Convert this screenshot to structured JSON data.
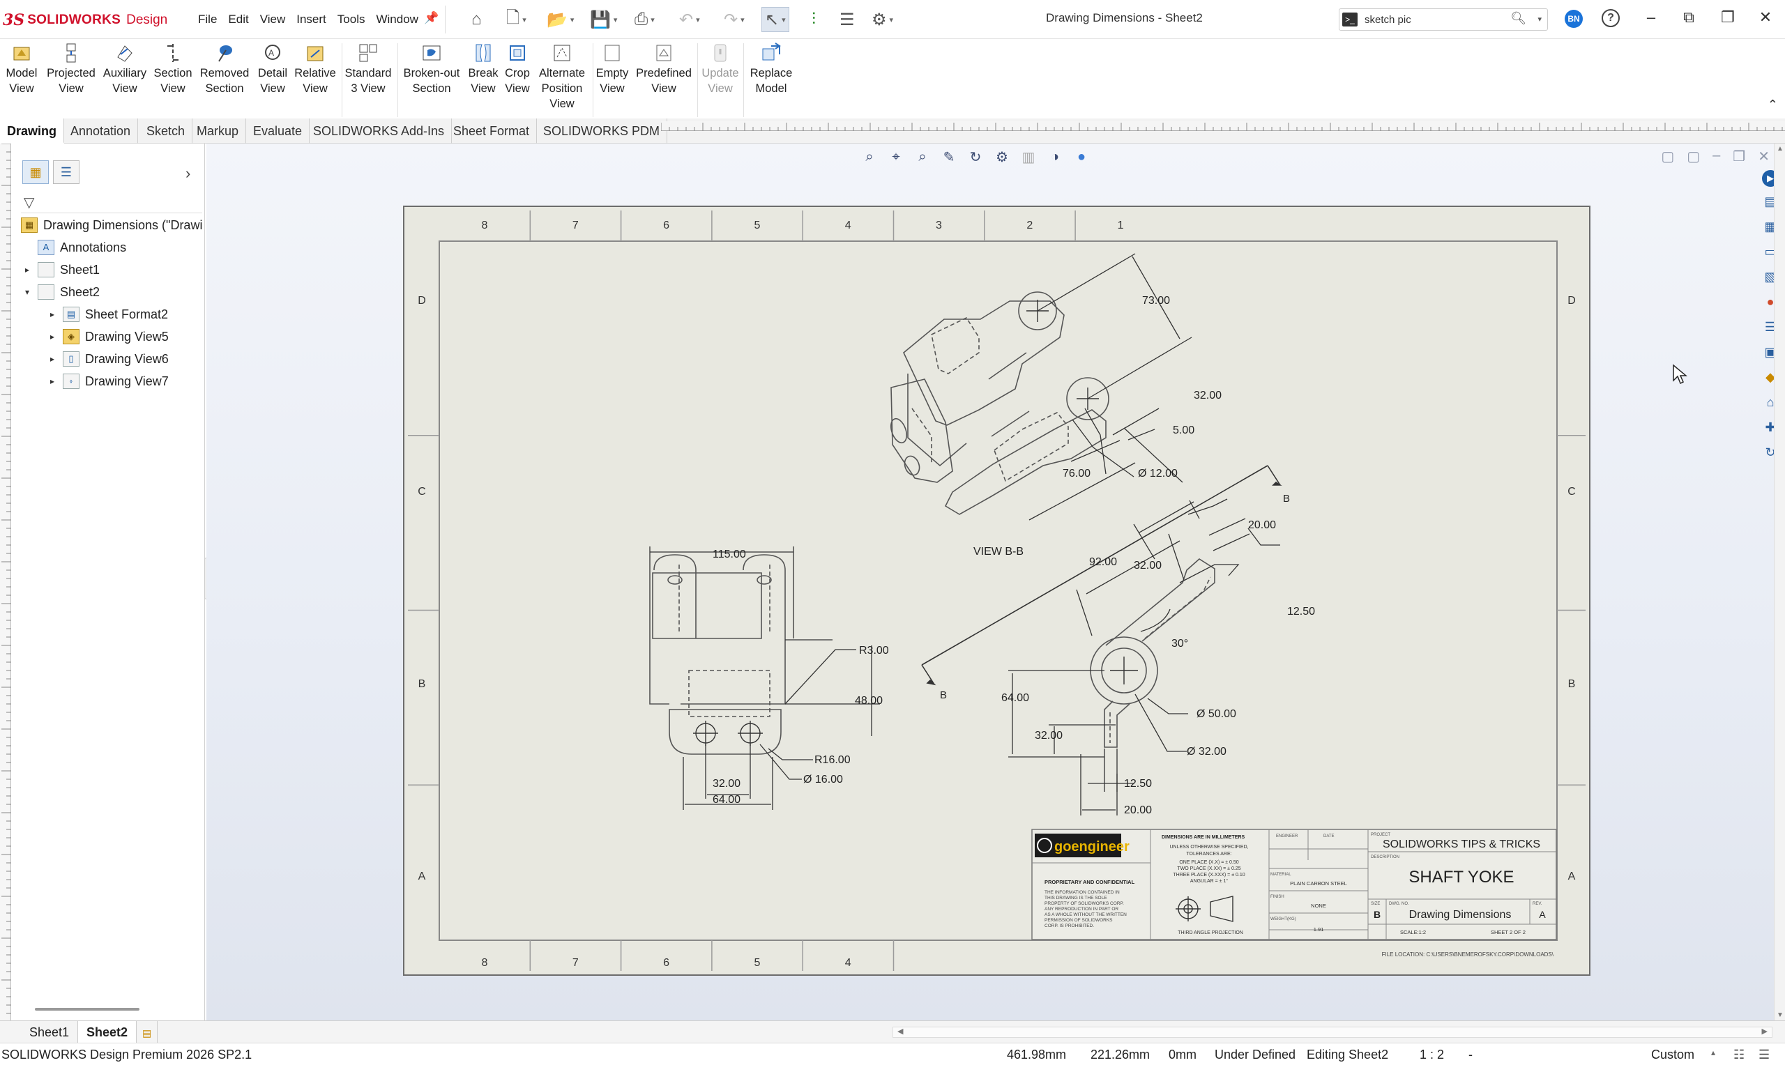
{
  "app": {
    "brand_ds": "3S",
    "brand_name": "SOLIDWORKS",
    "brand_suffix": "Design"
  },
  "menu": [
    "File",
    "Edit",
    "View",
    "Insert",
    "Tools",
    "Window"
  ],
  "window_title": "Drawing Dimensions - Sheet2",
  "search": {
    "value": "sketch pic",
    "placeholder": ""
  },
  "user_initials": "BN",
  "command_manager": [
    {
      "label": "Model\nView",
      "enabled": true
    },
    {
      "label": "Projected\nView",
      "enabled": true
    },
    {
      "label": "Auxiliary\nView",
      "enabled": true
    },
    {
      "label": "Section\nView",
      "enabled": true
    },
    {
      "label": "Removed\nSection",
      "enabled": true
    },
    {
      "label": "Detail\nView",
      "enabled": true
    },
    {
      "label": "Relative\nView",
      "enabled": true
    },
    {
      "label": "Standard\n3 View",
      "enabled": true
    },
    {
      "label": "Broken-out\nSection",
      "enabled": true
    },
    {
      "label": "Break\nView",
      "enabled": true
    },
    {
      "label": "Crop\nView",
      "enabled": true
    },
    {
      "label": "Alternate\nPosition\nView",
      "enabled": true
    },
    {
      "label": "Empty\nView",
      "enabled": true
    },
    {
      "label": "Predefined\nView",
      "enabled": true
    },
    {
      "label": "Update\nView",
      "enabled": false
    },
    {
      "label": "Replace\nModel",
      "enabled": true
    }
  ],
  "tabs": [
    "Drawing",
    "Annotation",
    "Sketch",
    "Markup",
    "Evaluate",
    "SOLIDWORKS Add-Ins",
    "Sheet Format",
    "SOLIDWORKS PDM"
  ],
  "active_tab": "Drawing",
  "tree": {
    "root": "Drawing Dimensions (\"Drawi",
    "items": [
      {
        "label": "Annotations"
      },
      {
        "label": "Sheet1"
      },
      {
        "label": "Sheet2"
      },
      {
        "label": "Sheet Format2"
      },
      {
        "label": "Drawing View5"
      },
      {
        "label": "Drawing View6"
      },
      {
        "label": "Drawing View7"
      }
    ]
  },
  "sheet": {
    "zone_cols": [
      "8",
      "7",
      "6",
      "5",
      "4",
      "3",
      "2",
      "1"
    ],
    "zone_rows": [
      "D",
      "C",
      "B",
      "A"
    ],
    "view_label": "VIEW B-B",
    "section_letter": "B",
    "dims_iso": [
      "73.00",
      "32.00",
      "5.00",
      "76.00",
      "Ø 12.00"
    ],
    "dims_front": [
      "115.00",
      "R3.00",
      "48.00",
      "R16.00",
      "Ø 16.00",
      "32.00",
      "64.00"
    ],
    "dims_section": [
      "20.00",
      "92.00",
      "32.00",
      "12.50",
      "30°",
      "64.00",
      "32.00",
      "Ø 50.00",
      "Ø 32.00",
      "12.50",
      "20.00"
    ]
  },
  "title_block": {
    "company": "goengineer",
    "dims_note": "DIMENSIONS ARE IN MILLIMETERS",
    "tol_lines": [
      "UNLESS OTHERWISE SPECIFIED,",
      "TOLERANCES ARE:",
      "ONE PLACE (X.X) = ± 0.50",
      "TWO PLACE (X.XX) = ± 0.25",
      "THREE PLACE (X.XXX) = ± 0.10",
      "ANGULAR = ± 1°"
    ],
    "prop_title": "PROPRIETARY AND CONFIDENTIAL",
    "prop_lines": [
      "THE INFORMATION CONTAINED IN",
      "THIS DRAWING IS THE SOLE",
      "PROPERTY OF SOLIDWORKS CORP.",
      "ANY REPRODUCTION IN PART OR",
      "AS A WHOLE WITHOUT THE WRITTEN",
      "PERMISSION OF SOLIDWORKS",
      "CORP. IS PROHIBITED."
    ],
    "engineer_label": "ENGINEER",
    "date_label": "DATE",
    "material_label": "MATERIAL",
    "material": "PLAIN CARBON STEEL",
    "finish_label": "FINISH",
    "finish": "NONE",
    "weight_label": "WEIGHT(KG)",
    "weight": "1.91",
    "projection": "THIRD ANGLE PROJECTION",
    "project_label": "PROJECT",
    "project": "SOLIDWORKS TIPS & TRICKS",
    "description_label": "DESCRIPTION",
    "description": "SHAFT YOKE",
    "size_label": "SIZE",
    "size": "B",
    "dwg_label": "DWG. NO.",
    "dwg_no": "Drawing Dimensions",
    "rev_label": "REV.",
    "rev": "A",
    "scale": "SCALE:1:2",
    "sheet_of": "SHEET 2 OF 2",
    "file_location": "FILE LOCATION: C:\\USERS\\BNEMEROFSKY.CORP\\DOWNLOADS\\"
  },
  "sheet_tabs": [
    "Sheet1",
    "Sheet2"
  ],
  "active_sheet": "Sheet2",
  "status": {
    "product": "SOLIDWORKS Design Premium 2026 SP2.1",
    "x": "461.98mm",
    "y": "221.26mm",
    "z": "0mm",
    "state": "Under Defined",
    "editing": "Editing Sheet2",
    "scale": "1 : 2",
    "units": "Custom"
  },
  "colors": {
    "accent": "#d0112b",
    "sheet": "#e8e8e0",
    "link_blue": "#1a73d9"
  }
}
